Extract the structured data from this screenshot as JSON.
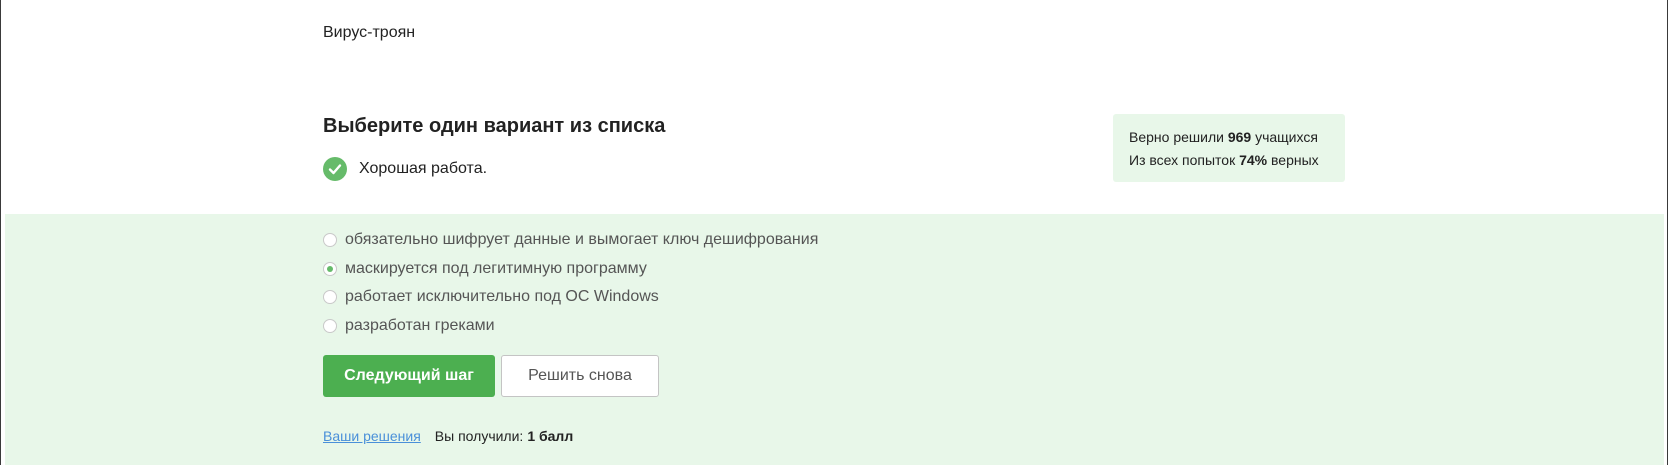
{
  "step": {
    "text": "Вирус-троян"
  },
  "quiz": {
    "title": "Выберите один вариант из списка",
    "feedback": "Хорошая работа.",
    "stats": {
      "solved_prefix": "Верно решили",
      "solved_count": "969",
      "solved_suffix": "учащихся",
      "attempts_prefix": "Из всех попыток",
      "attempts_percent": "74%",
      "attempts_suffix": "верных"
    },
    "options": [
      {
        "label": "обязательно шифрует данные и вымогает ключ дешифрования",
        "selected": false
      },
      {
        "label": "маскируется под легитимную программу",
        "selected": true
      },
      {
        "label": "работает исключительно под ОС Windows",
        "selected": false
      },
      {
        "label": "разработан греками",
        "selected": false
      }
    ],
    "buttons": {
      "next_label": "Следующий шаг",
      "retry_label": "Решить снова"
    },
    "footer": {
      "solutions_link": "Ваши решения",
      "score_label": "Вы получили:",
      "score_value": "1 балл"
    }
  },
  "colors": {
    "accent_green": "#4caf50",
    "success_bg": "#e8f7e9",
    "link_blue": "#4a90d9"
  },
  "icons": {
    "feedback": "check-circle-icon",
    "option_unselected": "radio-empty-icon",
    "option_selected": "radio-checked-icon"
  }
}
